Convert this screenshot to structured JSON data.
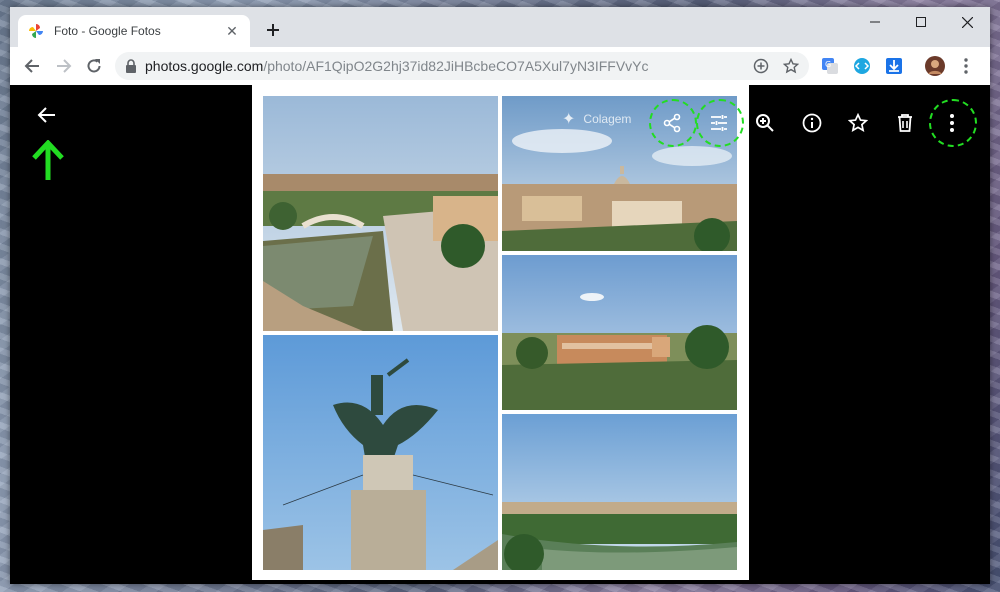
{
  "browser": {
    "tab_title": "Foto - Google Fotos",
    "url_host": "photos.google.com",
    "url_path": "/photo/AF1QipO2G2hj37id82JiHBcbeCO7A5Xul7yN3IFFVvYc"
  },
  "viewer": {
    "collage_label": "Colagem",
    "toolbar_icons": [
      "share-icon",
      "edit-tune-icon",
      "zoom-icon",
      "info-icon",
      "favorite-star-icon",
      "delete-icon",
      "more-options-icon"
    ]
  },
  "annotations": {
    "highlight_color": "#22dd22",
    "arrow_color": "#22dd22"
  },
  "photos": [
    "Castel Sant'Angelo river view",
    "Rome skyline with St. Peter's",
    "Palazzo di Giustizia",
    "Angel statue",
    "Tiber river panorama"
  ]
}
